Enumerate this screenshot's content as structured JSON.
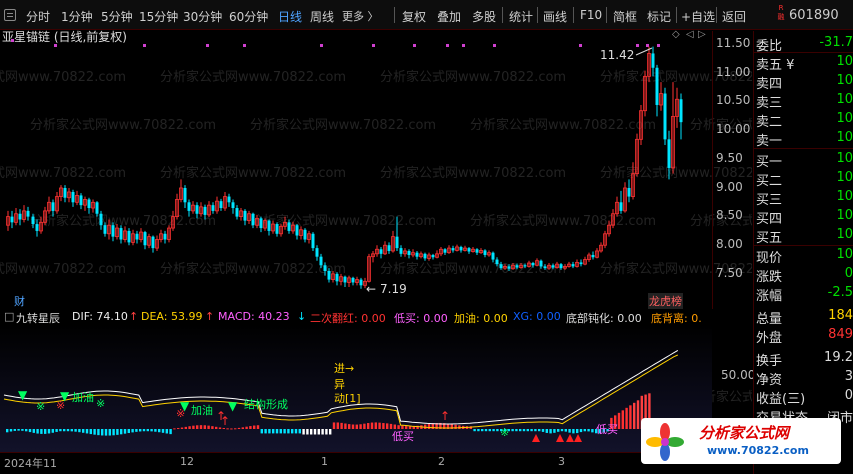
{
  "toolbar": {
    "periods": [
      {
        "label": "分时",
        "active": false
      },
      {
        "label": "1分钟",
        "active": false
      },
      {
        "label": "5分钟",
        "active": false
      },
      {
        "label": "15分钟",
        "active": false
      },
      {
        "label": "30分钟",
        "active": false
      },
      {
        "label": "60分钟",
        "active": false
      },
      {
        "label": "日线",
        "active": true
      },
      {
        "label": "周线",
        "active": false
      }
    ],
    "more": "更多 〉",
    "tools": [
      "复权",
      "叠加",
      "多股",
      "统计",
      "画线",
      "F10",
      "简框",
      "标记",
      "+自选",
      "返回"
    ],
    "code": "601890",
    "badge": "R 融"
  },
  "chart": {
    "title": "亚星锚链 (日线,前复权)",
    "high_label": "11.42",
    "low_label": "7.19",
    "cai_tag": "财",
    "rank_tag": "龙虎榜",
    "price_ticks": [
      "11.50",
      "11.00",
      "10.50",
      "10.00",
      "9.50",
      "9.00",
      "8.50",
      "8.00",
      "7.50"
    ],
    "watermark": "分析家公式网www.70822.com"
  },
  "indicator": {
    "name": "九转星辰",
    "dif": "DIF: 74.10",
    "dea": "DEA: 53.99",
    "macd": "MACD: 40.23",
    "ercifanhong": "二次翻红: 0.00",
    "dimai": "低买: 0.00",
    "jiayou": "加油: 0.00",
    "xg": "XG: 0.00",
    "dibudunhua": "底部钝化: 0.00",
    "dibubeili": "底背离: 0.",
    "tick": "50.00",
    "annotations": [
      "进→",
      "异",
      "动[1]",
      "结构形成",
      "加油",
      "低买",
      "低买",
      "加油"
    ],
    "dif_arrow": "↑",
    "dea_arrow": "↑",
    "macd_arrow": "↓"
  },
  "dates": [
    "2024年11",
    "12",
    "1",
    "2",
    "3"
  ],
  "quote": {
    "weibi_label": "委比",
    "weibi_value": "-31.7",
    "sell": [
      {
        "label": "卖五 ¥",
        "value": "10"
      },
      {
        "label": "卖四",
        "value": "10"
      },
      {
        "label": "卖三",
        "value": "10"
      },
      {
        "label": "卖二",
        "value": "10"
      },
      {
        "label": "卖一",
        "value": "10"
      }
    ],
    "buy": [
      {
        "label": "买一",
        "value": "10"
      },
      {
        "label": "买二",
        "value": "10"
      },
      {
        "label": "买三",
        "value": "10"
      },
      {
        "label": "买四",
        "value": "10"
      },
      {
        "label": "买五",
        "value": "10"
      }
    ],
    "stats": [
      {
        "label": "现价",
        "value": "10"
      },
      {
        "label": "涨跌",
        "value": "0"
      },
      {
        "label": "涨幅",
        "value": "-2.5"
      },
      {
        "label": "总量",
        "value": "184"
      },
      {
        "label": "外盘",
        "value": "849"
      },
      {
        "label": "换手",
        "value": "19.2"
      },
      {
        "label": "净资",
        "value": "3"
      },
      {
        "label": "收益(三)",
        "value": "0"
      },
      {
        "label": "交易状态",
        "value": "闭市"
      }
    ]
  },
  "logo": {
    "title": "分析家公式网",
    "url": "www.70822.com"
  },
  "colors": {
    "up": "#ff3232",
    "down": "#00e5ff",
    "background": "#000000",
    "accent": "#4fa3ff"
  }
}
